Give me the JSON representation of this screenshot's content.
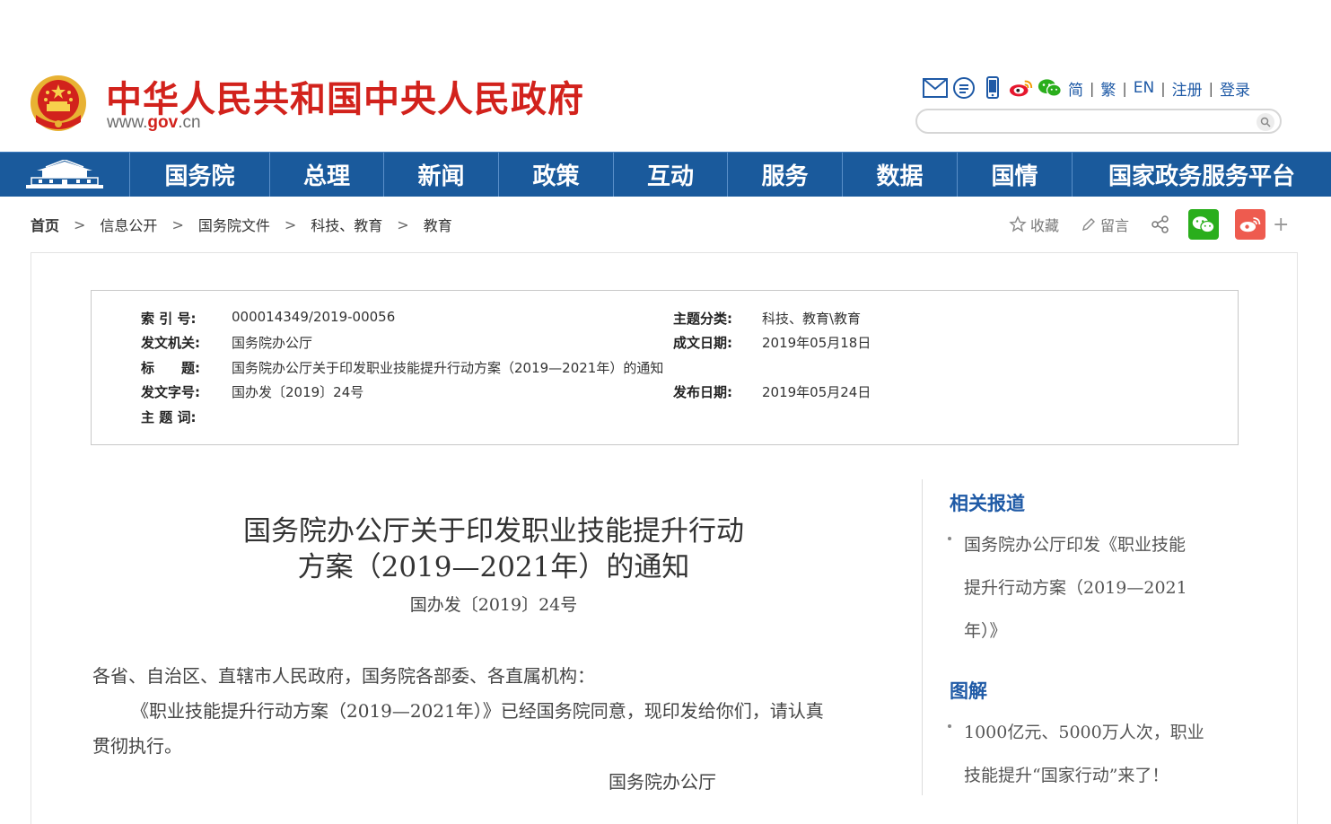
{
  "header": {
    "site_title": "中华人民共和国中央人民政府",
    "url_prefix": "www.",
    "url_gov": "gov",
    "url_suffix": ".cn",
    "icons": [
      "mail-icon",
      "message-icon",
      "mobile-icon",
      "weibo-icon",
      "wechat-icon"
    ],
    "links": [
      "简",
      "繁",
      "EN",
      "注册",
      "登录"
    ],
    "search_placeholder": ""
  },
  "nav": {
    "items": [
      "国务院",
      "总理",
      "新闻",
      "政策",
      "互动",
      "服务",
      "数据",
      "国情",
      "国家政务服务平台"
    ]
  },
  "breadcrumb": [
    "首页",
    "信息公开",
    "国务院文件",
    "科技、教育",
    "教育"
  ],
  "share": {
    "favorite": "收藏",
    "comment": "留言",
    "more": "+"
  },
  "info": {
    "index_label": "索 引 号:",
    "index_value": "000014349/2019-00056",
    "topic_label": "主题分类:",
    "topic_value": "科技、教育\\教育",
    "issuer_label": "发文机关:",
    "issuer_value": "国务院办公厅",
    "written_label": "成文日期:",
    "written_value": "2019年05月18日",
    "title_label": "标　　题:",
    "title_value": "国务院办公厅关于印发职业技能提升行动方案（2019—2021年）的通知",
    "docno_label": "发文字号:",
    "docno_value": "国办发〔2019〕24号",
    "published_label": "发布日期:",
    "published_value": "2019年05月24日",
    "keywords_label": "主 题 词:",
    "keywords_value": ""
  },
  "article": {
    "title_line1": "国务院办公厅关于印发职业技能提升行动",
    "title_line2": "方案（2019—2021年）的通知",
    "doc_number": "国办发〔2019〕24号",
    "salutation": "各省、自治区、直辖市人民政府，国务院各部委、各直属机构：",
    "para1_line1": "《职业技能提升行动方案（2019—2021年）》已经国务院同意，现印发给你们，请认真",
    "para1_line2": "贯彻执行。",
    "signature": "国务院办公厅"
  },
  "sidebar": {
    "related_heading": "相关报道",
    "related_lines": [
      "国务院办公厅印发《职业技能",
      "提升行动方案（2019—2021",
      "年）》"
    ],
    "graphic_heading": "图解",
    "graphic_lines": [
      "1000亿元、5000万人次，职业",
      "技能提升“国家行动”来了！"
    ]
  },
  "colors": {
    "brand_red": "#d2221c",
    "nav_blue": "#1a5a9c",
    "link_blue": "#1f5aa6",
    "wechat_green": "#2aae1c",
    "weibo_red": "#ee5b4f"
  }
}
